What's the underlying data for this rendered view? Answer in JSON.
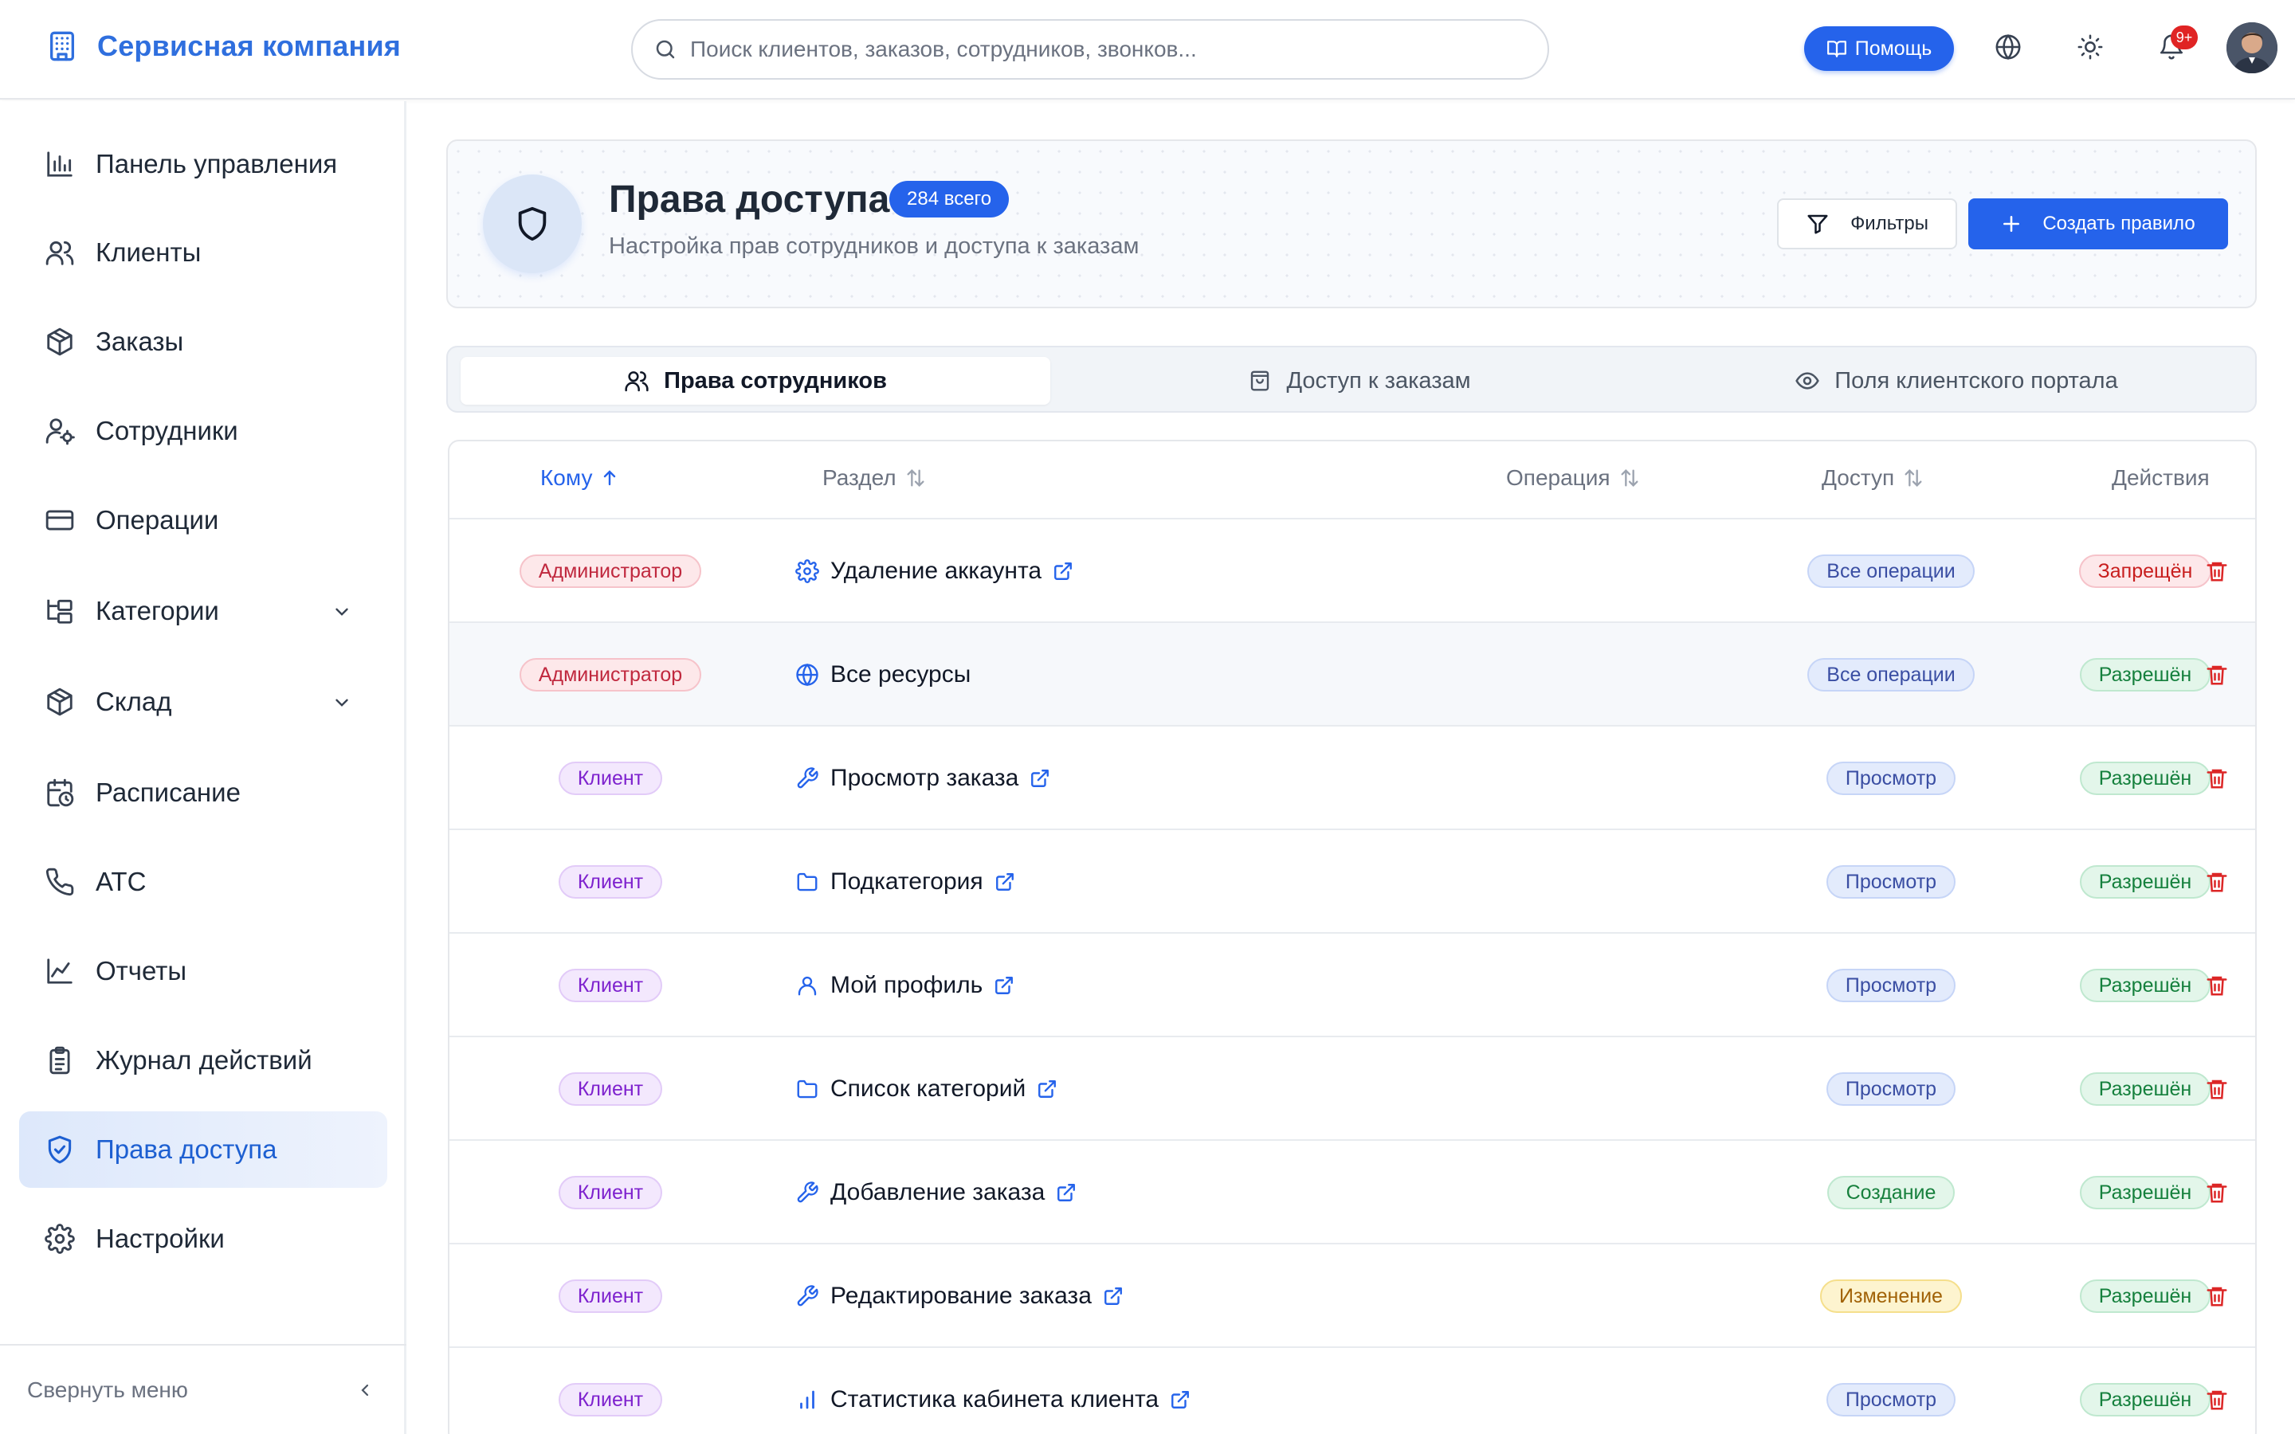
{
  "header": {
    "brand": "Сервисная компания",
    "search_placeholder": "Поиск клиентов, заказов, сотрудников, звонков...",
    "help_label": "Помощь",
    "notifications_badge": "9+"
  },
  "sidebar": {
    "items": [
      {
        "label": "Панель управления",
        "icon": "bar-chart-icon"
      },
      {
        "label": "Клиенты",
        "icon": "users-icon"
      },
      {
        "label": "Заказы",
        "icon": "package-icon"
      },
      {
        "label": "Сотрудники",
        "icon": "user-cog-icon"
      },
      {
        "label": "Операции",
        "icon": "credit-card-icon"
      },
      {
        "label": "Категории",
        "icon": "folder-tree-icon",
        "expandable": true
      },
      {
        "label": "Склад",
        "icon": "package-icon",
        "expandable": true
      },
      {
        "label": "Расписание",
        "icon": "calendar-clock-icon"
      },
      {
        "label": "АТС",
        "icon": "phone-icon"
      },
      {
        "label": "Отчеты",
        "icon": "line-chart-icon"
      },
      {
        "label": "Журнал действий",
        "icon": "clipboard-list-icon"
      },
      {
        "label": "Права доступа",
        "icon": "shield-check-icon",
        "active": true
      },
      {
        "label": "Настройки",
        "icon": "gear-icon"
      }
    ],
    "collapse_label": "Свернуть меню"
  },
  "page": {
    "title": "Права доступа",
    "count_badge": "284 всего",
    "subtitle": "Настройка прав сотрудников и доступа к заказам",
    "filters_label": "Фильтры",
    "create_label": "Создать правило"
  },
  "tabs": [
    {
      "label": "Права сотрудников",
      "active": true
    },
    {
      "label": "Доступ к заказам",
      "active": false
    },
    {
      "label": "Поля клиентского портала",
      "active": false
    }
  ],
  "table": {
    "columns": {
      "who": "Кому",
      "section": "Раздел",
      "operation": "Операция",
      "access": "Доступ",
      "actions": "Действия"
    },
    "rows": [
      {
        "who": "Администратор",
        "section": "Удаление аккаунта",
        "section_icon": "gear-icon",
        "external_link": true,
        "operation": "Все операции",
        "access": "Запрещён"
      },
      {
        "who": "Администратор",
        "section": "Все ресурсы",
        "section_icon": "globe-icon",
        "external_link": false,
        "operation": "Все операции",
        "access": "Разрешён"
      },
      {
        "who": "Клиент",
        "section": "Просмотр заказа",
        "section_icon": "wrench-icon",
        "external_link": true,
        "operation": "Просмотр",
        "access": "Разрешён"
      },
      {
        "who": "Клиент",
        "section": "Подкатегория",
        "section_icon": "folder-icon",
        "external_link": true,
        "operation": "Просмотр",
        "access": "Разрешён"
      },
      {
        "who": "Клиент",
        "section": "Мой профиль",
        "section_icon": "user-icon",
        "external_link": true,
        "operation": "Просмотр",
        "access": "Разрешён"
      },
      {
        "who": "Клиент",
        "section": "Список категорий",
        "section_icon": "folder-icon",
        "external_link": true,
        "operation": "Просмотр",
        "access": "Разрешён"
      },
      {
        "who": "Клиент",
        "section": "Добавление заказа",
        "section_icon": "wrench-icon",
        "external_link": true,
        "operation": "Создание",
        "access": "Разрешён"
      },
      {
        "who": "Клиент",
        "section": "Редактирование заказа",
        "section_icon": "wrench-icon",
        "external_link": true,
        "operation": "Изменение",
        "access": "Разрешён"
      },
      {
        "who": "Клиент",
        "section": "Статистика кабинета клиента",
        "section_icon": "bar-chart-icon",
        "external_link": true,
        "operation": "Просмотр",
        "access": "Разрешён"
      }
    ]
  },
  "colors": {
    "accent": "#2563eb",
    "danger": "#dc2626",
    "success": "#15803d"
  }
}
